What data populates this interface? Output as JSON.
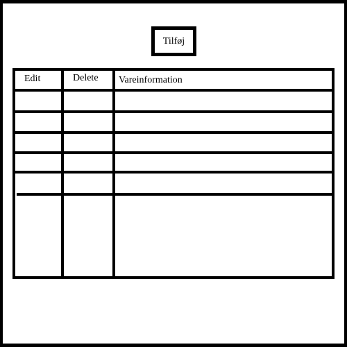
{
  "toolbar": {
    "add_label": "Tilføj"
  },
  "table": {
    "columns": [
      "Edit",
      "Delete",
      "Vareinformation"
    ]
  }
}
